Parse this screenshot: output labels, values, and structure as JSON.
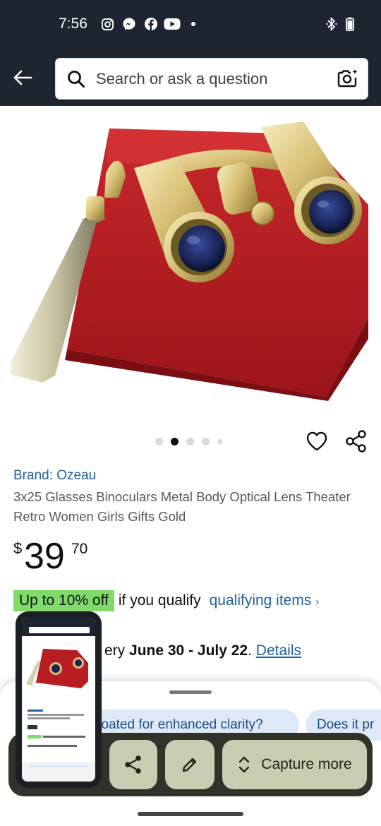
{
  "status_bar": {
    "time": "7:56"
  },
  "search": {
    "placeholder": "Search or ask a question"
  },
  "product": {
    "brand": "Brand: Ozeau",
    "title": "3x25 Glasses Binoculars Metal Body Optical Lens Theater Retro Women Girls Gifts Gold",
    "price": {
      "symbol": "$",
      "whole": "39",
      "fraction": "70"
    },
    "carousel": {
      "count": 5,
      "active_index": 1
    }
  },
  "deal": {
    "badge": "Up to 10% off",
    "text": "if you qualify",
    "link": "qualifying items"
  },
  "delivery": {
    "prefix": "ery",
    "dates": "June 30 - July 22",
    "link": "Details"
  },
  "sheet": {
    "chips": [
      "coated for enhanced clarity?",
      "Does it pr"
    ],
    "capture_label": "Capture more"
  },
  "colors": {
    "header_bg": "#1d2630",
    "link": "#2162a1",
    "deal_green": "#7fda69",
    "toolbar_bg": "#2f3329",
    "tool_button": "#c7cdb0"
  }
}
